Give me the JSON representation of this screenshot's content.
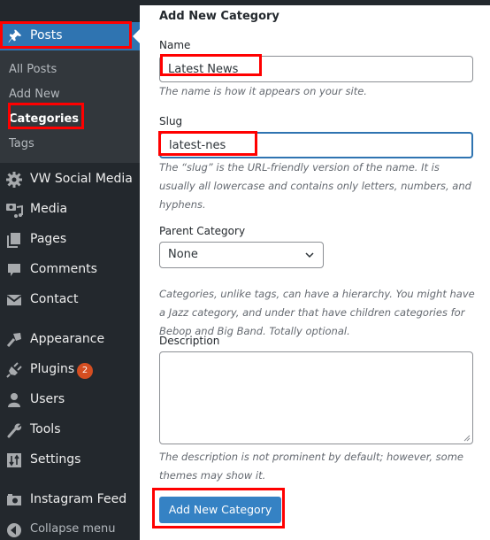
{
  "sidebar": {
    "current": {
      "label": "Posts",
      "icon": "pin-icon"
    },
    "submenu": [
      {
        "label": "All Posts",
        "active": false
      },
      {
        "label": "Add New",
        "active": false
      },
      {
        "label": "Categories",
        "active": true
      },
      {
        "label": "Tags",
        "active": false
      }
    ],
    "items": [
      {
        "label": "VW Social Media",
        "icon": "gear-icon"
      },
      {
        "label": "Media",
        "icon": "media-icon"
      },
      {
        "label": "Pages",
        "icon": "pages-icon"
      },
      {
        "label": "Comments",
        "icon": "comment-icon"
      },
      {
        "label": "Contact",
        "icon": "envelope-icon"
      },
      {
        "label": "Appearance",
        "icon": "paintbrush-icon"
      },
      {
        "label": "Plugins",
        "icon": "plug-icon",
        "badge": "2"
      },
      {
        "label": "Users",
        "icon": "user-icon"
      },
      {
        "label": "Tools",
        "icon": "wrench-icon"
      },
      {
        "label": "Settings",
        "icon": "settings-icon"
      },
      {
        "label": "Instagram Feed",
        "icon": "camera-icon"
      }
    ],
    "collapse_label": "Collapse menu"
  },
  "form": {
    "title": "Add New Category",
    "name": {
      "label": "Name",
      "value": "Latest News",
      "help": "The name is how it appears on your site."
    },
    "slug": {
      "label": "Slug",
      "value": "latest-nes",
      "help": "The “slug” is the URL-friendly version of the name. It is usually all lowercase and contains only letters, numbers, and hyphens."
    },
    "parent": {
      "label": "Parent Category",
      "selected": "None",
      "help": "Categories, unlike tags, can have a hierarchy. You might have a Jazz category, and under that have children categories for Bebop and Big Band. Totally optional."
    },
    "description": {
      "label": "Description",
      "value": "",
      "help": "The description is not prominent by default; however, some themes may show it."
    },
    "submit_label": "Add New Category"
  },
  "colors": {
    "sidebar_bg": "#23282d",
    "submenu_bg": "#32373c",
    "accent": "#2f74b1",
    "button": "#3582c4",
    "badge": "#d54e21",
    "annotation": "#ff0000"
  }
}
